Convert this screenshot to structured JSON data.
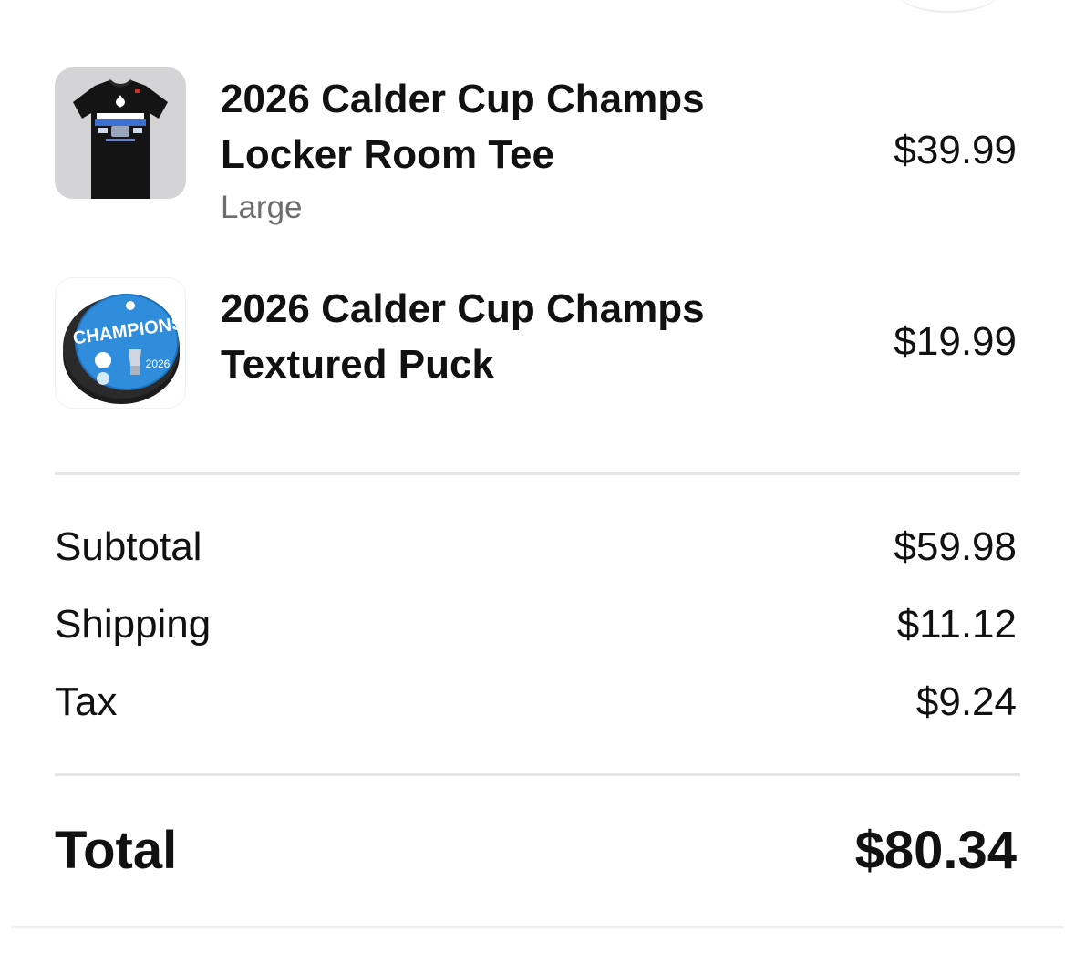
{
  "items": [
    {
      "title_line1": "2026 Calder Cup Champs",
      "title_line2": "Locker Room Tee",
      "variant": "Large",
      "price": "$39.99",
      "thumbnail_icon": "tshirt-image"
    },
    {
      "title_line1": "2026 Calder Cup Champs",
      "title_line2": "Textured Puck",
      "price": "$19.99",
      "thumbnail_icon": "hockey-puck-image",
      "thumbnail_text": {
        "banner": "CHAMPIONS",
        "year": "2026"
      }
    }
  ],
  "summary": {
    "subtotal_label": "Subtotal",
    "subtotal_value": "$59.98",
    "shipping_label": "Shipping",
    "shipping_value": "$11.12",
    "tax_label": "Tax",
    "tax_value": "$9.24",
    "total_label": "Total",
    "total_value": "$80.34"
  },
  "colors": {
    "text": "#111111",
    "secondary_text": "#6d6d6d",
    "divider": "#e6e6e9",
    "tee_background": "#d4d4d6",
    "puck_blue": "#2f8ddb"
  }
}
